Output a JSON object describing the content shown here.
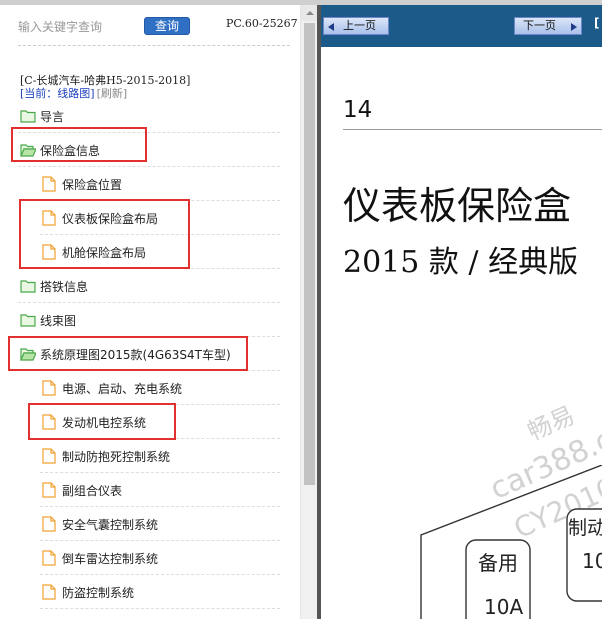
{
  "search": {
    "placeholder": "输入关键字查询",
    "button_label": "查询",
    "version": "PC.60-25267"
  },
  "header": {
    "model_title": "[C-长城汽车-哈弗H5-2015-2018]",
    "current_label": "[当前：线路图]",
    "refresh_label": "[刷新]"
  },
  "tree": [
    {
      "label": "导言",
      "icon": "folder-icon",
      "open": false
    },
    {
      "label": "保险盒信息",
      "icon": "folder-open-icon",
      "open": true
    },
    {
      "label": "保险盒位置",
      "icon": "document-icon"
    },
    {
      "label": "仪表板保险盒布局",
      "icon": "document-icon"
    },
    {
      "label": "机舱保险盒布局",
      "icon": "document-icon"
    },
    {
      "label": "搭铁信息",
      "icon": "folder-icon",
      "open": false
    },
    {
      "label": "线束图",
      "icon": "folder-icon",
      "open": false
    },
    {
      "label": "系统原理图2015款(4G63S4T车型)",
      "icon": "folder-open-icon",
      "open": true
    },
    {
      "label": "电源、启动、充电系统",
      "icon": "document-icon"
    },
    {
      "label": "发动机电控系统",
      "icon": "document-icon"
    },
    {
      "label": "制动防抱死控制系统",
      "icon": "document-icon"
    },
    {
      "label": "副组合仪表",
      "icon": "document-icon"
    },
    {
      "label": "安全气囊控制系统",
      "icon": "document-icon"
    },
    {
      "label": "倒车雷达控制系统",
      "icon": "document-icon"
    },
    {
      "label": "防盗控制系统",
      "icon": "document-icon"
    }
  ],
  "viewer": {
    "prev_label": "上一页",
    "next_label": "下一页",
    "bar_extra": "[",
    "page_number": "14",
    "doc_title": "仪表板保险盒",
    "doc_subtitle": "2015 款 / 经典版",
    "watermark": [
      "畅易",
      "car388.c",
      "CY2010"
    ],
    "fuses": [
      {
        "label": "备用",
        "amp": "10A"
      },
      {
        "label": "制动",
        "amp": "10"
      }
    ]
  },
  "colors": {
    "accent": "#2f6fc4",
    "highlight": "#e03030",
    "viewer_bar": "#1c5a8a",
    "folder": "#5cb85c",
    "document": "#f0a030"
  }
}
